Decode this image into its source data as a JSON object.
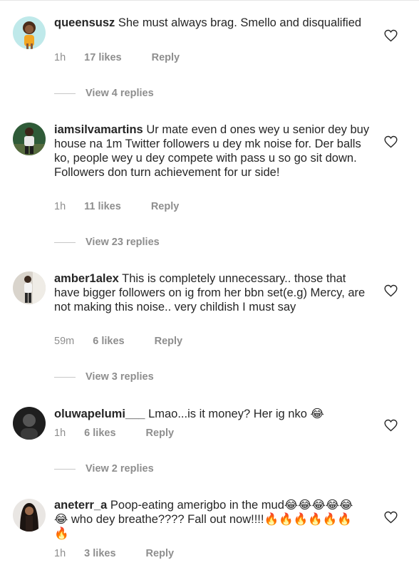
{
  "comments": [
    {
      "username": "queensusz",
      "text": "She must always brag. Smello and disqualified",
      "time": "1h",
      "likes": "17 likes",
      "reply_label": "Reply",
      "view_replies": "View 4 replies",
      "avatar_icon": "cartoon-girl-avatar"
    },
    {
      "username": "iamsilvamartins",
      "text": "Ur mate even d ones wey u senior dey buy house na 1m Twitter followers u dey mk noise for. Der balls ko, people wey u dey compete with pass u so go sit down. Followers don turn achievement for ur side!",
      "time": "1h",
      "likes": "11 likes",
      "reply_label": "Reply",
      "view_replies": "View 23 replies",
      "avatar_icon": "person-photo-avatar"
    },
    {
      "username": "amber1alex",
      "text": "This is completely unnecessary.. those that have  bigger followers on ig  from her bbn set(e.g) Mercy, are not making this noise.. very childish I must say",
      "time": "59m",
      "likes": "6 likes",
      "reply_label": "Reply",
      "view_replies": "View 3 replies",
      "avatar_icon": "person-photo-avatar"
    },
    {
      "username": "oluwapelumi___",
      "text": "Lmao...is it money? Her ig nko 😂",
      "time": "1h",
      "likes": "6 likes",
      "reply_label": "Reply",
      "view_replies": "View 2 replies",
      "avatar_icon": "dark-portrait-avatar"
    },
    {
      "username": "aneterr_a",
      "text": "Poop-eating amerigbo in the mud😂😂😂😂😂😂 who dey breathe???? Fall out now!!!!🔥🔥🔥🔥🔥🔥🔥",
      "time": "1h",
      "likes": "3 likes",
      "reply_label": "Reply",
      "avatar_icon": "woman-photo-avatar"
    }
  ],
  "heart_icon": "heart-outline-icon",
  "colors": {
    "text": "#262626",
    "meta": "#8e8e8e",
    "background": "#ffffff"
  }
}
